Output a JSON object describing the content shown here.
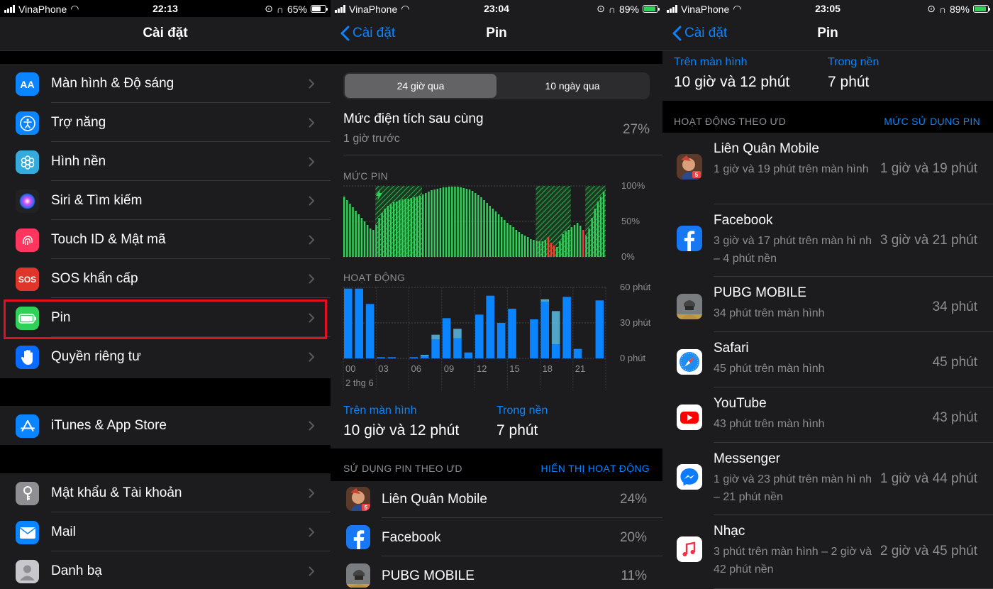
{
  "panel1": {
    "status": {
      "carrier": "VinaPhone",
      "time": "22:13",
      "battery": "65%",
      "battery_level": 0.65
    },
    "title": "Cài đặt",
    "group1": [
      {
        "label": "Màn hình & Độ sáng",
        "icon": "display-brightness-icon",
        "glyph": "AA",
        "color": "#0a84ff"
      },
      {
        "label": "Trợ năng",
        "icon": "accessibility-icon",
        "glyph": "",
        "color": "#0a84ff"
      },
      {
        "label": "Hình nền",
        "icon": "wallpaper-icon",
        "glyph": "",
        "color": "#35aadc"
      },
      {
        "label": "Siri & Tìm kiếm",
        "icon": "siri-icon",
        "glyph": "",
        "color": "#222"
      },
      {
        "label": "Touch ID & Mật mã",
        "icon": "fingerprint-icon",
        "glyph": "",
        "color": "#ff375f"
      },
      {
        "label": "SOS khẩn cấp",
        "icon": "sos-icon",
        "glyph": "SOS",
        "color": "#e0352b"
      },
      {
        "label": "Pin",
        "icon": "battery-icon",
        "glyph": "",
        "color": "#30d158"
      },
      {
        "label": "Quyền riêng tư",
        "icon": "privacy-hand-icon",
        "glyph": "",
        "color": "#0a6cff"
      }
    ],
    "group2": [
      {
        "label": "iTunes & App Store",
        "icon": "app-store-icon",
        "glyph": "",
        "color": "#0a84ff"
      }
    ],
    "group3": [
      {
        "label": "Mật khẩu & Tài khoản",
        "icon": "key-icon",
        "glyph": "",
        "color": "#8e8e93"
      },
      {
        "label": "Mail",
        "icon": "mail-icon",
        "glyph": "",
        "color": "#0a84ff"
      },
      {
        "label": "Danh bạ",
        "icon": "contacts-icon",
        "glyph": "",
        "color": "#aaa"
      }
    ]
  },
  "panel2": {
    "status": {
      "carrier": "VinaPhone",
      "time": "23:04",
      "battery": "89%",
      "battery_level": 0.89
    },
    "back": "Cài đặt",
    "title": "Pin",
    "segments": [
      "24 giờ qua",
      "10 ngày qua"
    ],
    "last_charge": {
      "label": "Mức điện tích sau cùng",
      "sub": "1 giờ trước",
      "value": "27%"
    },
    "battery_level_label": "MỨC PIN",
    "activity_label": "HOẠT ĐỘNG",
    "on_screen": {
      "label": "Trên màn hình",
      "value": "10 giờ và 12 phút"
    },
    "background": {
      "label": "Trong nền",
      "value": "7 phút"
    },
    "usage_header": "SỬ DỤNG PIN THEO ƯD",
    "show_activity": "HIỂN THỊ HOẠT ĐỘNG",
    "apps": [
      {
        "name": "Liên Quân Mobile",
        "pct": "24%",
        "icon": "lien-quan-icon",
        "color": "#a0522d"
      },
      {
        "name": "Facebook",
        "pct": "20%",
        "icon": "facebook-icon",
        "color": "#1877f2"
      },
      {
        "name": "PUBG MOBILE",
        "pct": "11%",
        "icon": "pubg-icon",
        "color": "#6b6b6b"
      }
    ]
  },
  "panel3": {
    "status": {
      "carrier": "VinaPhone",
      "time": "23:05",
      "battery": "89%",
      "battery_level": 0.89
    },
    "back": "Cài đặt",
    "title": "Pin",
    "on_screen": {
      "label": "Trên màn hình",
      "value": "10 giờ và 12 phút"
    },
    "background": {
      "label": "Trong nền",
      "value": "7 phút"
    },
    "activity_header": "HOẠT ĐỘNG THEO ƯD",
    "battery_usage": "MỨC SỬ DỤNG PIN",
    "apps": [
      {
        "name": "Liên Quân Mobile",
        "sub": "1 giờ và 19 phút trên màn hình",
        "dur": "1 giờ và 19 phút",
        "icon": "lien-quan-icon",
        "color": "#a0522d"
      },
      {
        "name": "Facebook",
        "sub": "3 giờ và 17 phút trên màn hì nh – 4 phút nền",
        "dur": "3 giờ và 21 phút",
        "icon": "facebook-icon",
        "color": "#1877f2"
      },
      {
        "name": "PUBG MOBILE",
        "sub": "34 phút trên màn hình",
        "dur": "34 phút",
        "icon": "pubg-icon",
        "color": "#6b6b6b"
      },
      {
        "name": "Safari",
        "sub": "45 phút trên màn hình",
        "dur": "45 phút",
        "icon": "safari-icon",
        "color": "#fff"
      },
      {
        "name": "YouTube",
        "sub": "43 phút trên màn hình",
        "dur": "43 phút",
        "icon": "youtube-icon",
        "color": "#fff"
      },
      {
        "name": "Messenger",
        "sub": "1 giờ và 23 phút trên màn hì nh – 21 phút nền",
        "dur": "1 giờ và 44 phút",
        "icon": "messenger-icon",
        "color": "#fff"
      },
      {
        "name": "Nhạc",
        "sub": "3 phút trên màn hình – 2 giờ và 42 phút nền",
        "dur": "2 giờ và 45 phút",
        "icon": "music-icon",
        "color": "#fff"
      }
    ]
  },
  "chart_data": [
    {
      "type": "bar",
      "title": "MỨC PIN",
      "y_ticks": [
        "100%",
        "50%",
        "0%"
      ],
      "ylim": [
        0,
        100
      ],
      "values": [
        85,
        80,
        75,
        70,
        65,
        60,
        55,
        50,
        45,
        40,
        38,
        45,
        55,
        62,
        68,
        72,
        75,
        77,
        78,
        80,
        81,
        82,
        82,
        83,
        84,
        85,
        86,
        88,
        90,
        92,
        94,
        95,
        96,
        97,
        98,
        98,
        99,
        99,
        99,
        99,
        98,
        97,
        96,
        95,
        93,
        90,
        87,
        84,
        80,
        76,
        72,
        68,
        64,
        60,
        56,
        52,
        48,
        45,
        42,
        38,
        35,
        32,
        30,
        28,
        25,
        24,
        23,
        22,
        22,
        24,
        28,
        20,
        16,
        14,
        22,
        32,
        36,
        38,
        42,
        45,
        48,
        44,
        38,
        30,
        40,
        55,
        68,
        78,
        85,
        92
      ],
      "charging_ranges": [
        [
          11,
          27
        ],
        [
          66,
          78
        ],
        [
          83,
          90
        ]
      ],
      "low_indices": [
        70,
        71,
        72,
        82
      ]
    },
    {
      "type": "bar",
      "title": "HOẠT ĐỘNG",
      "x_ticks": [
        "00",
        "03",
        "06",
        "09",
        "12",
        "15",
        "18",
        "21"
      ],
      "x_sub": "2 thg 6",
      "y_ticks": [
        "60 phút",
        "30 phút",
        "0 phút"
      ],
      "ylim": [
        0,
        60
      ],
      "categories": [
        "0",
        "1",
        "2",
        "3",
        "4",
        "5",
        "6",
        "7",
        "8",
        "9",
        "10",
        "11",
        "12",
        "13",
        "14",
        "15",
        "16",
        "17",
        "18",
        "19",
        "20",
        "21",
        "22",
        "23"
      ],
      "series": [
        {
          "name": "Trên màn hình",
          "values": [
            59,
            59,
            46,
            1,
            1,
            0,
            1,
            2,
            16,
            34,
            17,
            5,
            37,
            53,
            30,
            42,
            0,
            33,
            48,
            12,
            52,
            8,
            0,
            49
          ]
        },
        {
          "name": "Trong nền",
          "values": [
            0,
            0,
            0,
            0,
            0,
            0,
            0,
            1,
            4,
            0,
            8,
            0,
            0,
            0,
            0,
            0,
            0,
            0,
            2,
            28,
            0,
            0,
            0,
            0
          ]
        }
      ]
    }
  ]
}
